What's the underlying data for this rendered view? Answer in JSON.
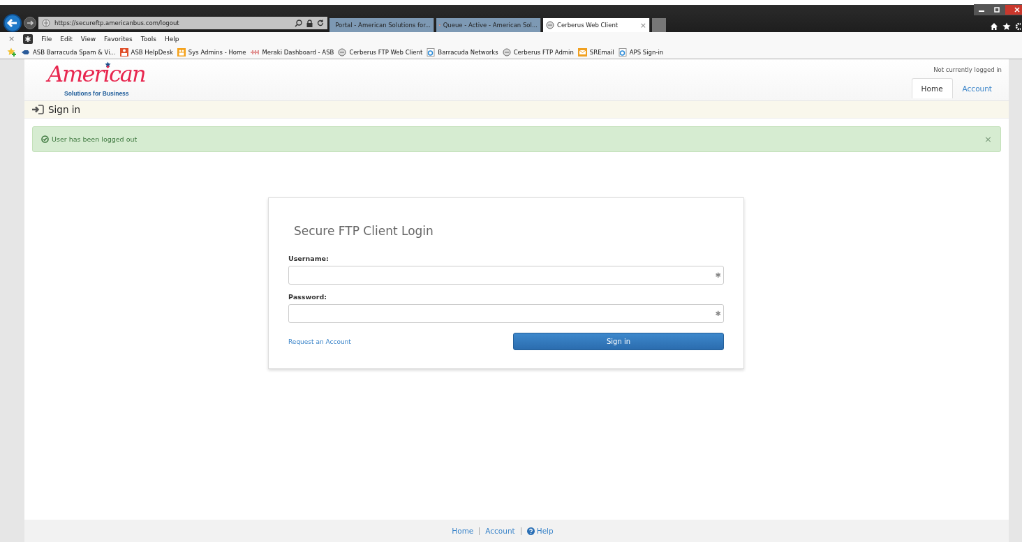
{
  "browser": {
    "address": "https://secureftp.americanbus.com/logout",
    "tabs": [
      {
        "label": "Portal - American Solutions for...",
        "selected": false
      },
      {
        "label": "Queue - Active - American Sol...",
        "selected": false
      },
      {
        "label": "Cerberus Web Client",
        "selected": true,
        "close": "×"
      }
    ],
    "menu": [
      "File",
      "Edit",
      "View",
      "Favorites",
      "Tools",
      "Help"
    ],
    "menu_close": "×",
    "favorites": [
      "ASB Barracuda Spam & Vi...",
      "ASB HelpDesk",
      "Sys Admins - Home",
      "Meraki Dashboard - ASB",
      "Cerberus FTP Web Client",
      "Barracuda Networks",
      "Cerberus FTP Admin",
      "SREmail",
      "APS Sign-in"
    ]
  },
  "header": {
    "logo_script": "American",
    "logo_tagline": "Solutions for Business",
    "login_status": "Not currently logged in",
    "nav": [
      {
        "label": "Home",
        "selected": true
      },
      {
        "label": "Account",
        "selected": false
      }
    ]
  },
  "breadcrumb": "Sign in",
  "alert": {
    "message": "User has been logged out",
    "close": "×"
  },
  "login": {
    "title": "Secure FTP Client Login",
    "fields": [
      {
        "label": "Username:",
        "required_mark": "✱"
      },
      {
        "label": "Password:",
        "required_mark": "✱"
      }
    ],
    "request_link": "Request an Account",
    "submit": "Sign in"
  },
  "footer": {
    "links": [
      {
        "label": "Home",
        "kind": "link"
      },
      {
        "label": "Account",
        "kind": "link"
      },
      {
        "label": "Help",
        "kind": "help"
      }
    ]
  }
}
